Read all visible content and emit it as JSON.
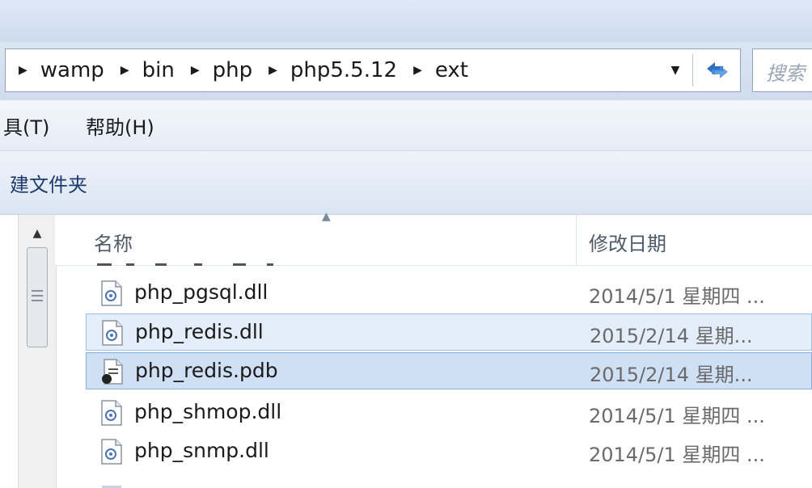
{
  "address": {
    "crumbs": [
      "wamp",
      "bin",
      "php",
      "php5.5.12",
      "ext"
    ],
    "search_placeholder": "搜索"
  },
  "menu": {
    "tools": "具(T)",
    "help": "帮助(H)"
  },
  "toolbar": {
    "new_folder": "建文件夹"
  },
  "columns": {
    "name": "名称",
    "date": "修改日期"
  },
  "files": [
    {
      "name": "php_pgsql.dll",
      "date": "2014/5/1 星期四 ...",
      "icon": "dll-file-icon",
      "state": "normal"
    },
    {
      "name": "php_redis.dll",
      "date": "2015/2/14 星期...",
      "icon": "dll-file-icon",
      "state": "selected"
    },
    {
      "name": "php_redis.pdb",
      "date": "2015/2/14 星期...",
      "icon": "pdb-file-icon",
      "state": "selected-focus"
    },
    {
      "name": "php_shmop.dll",
      "date": "2014/5/1 星期四 ...",
      "icon": "dll-file-icon",
      "state": "normal"
    },
    {
      "name": "php_snmp.dll",
      "date": "2014/5/1 星期四 ...",
      "icon": "dll-file-icon",
      "state": "normal"
    }
  ],
  "colors": {
    "selection": "#e4eefb",
    "selection_border": "#9fc0e8",
    "selection_focus": "#cfe0f5",
    "toolbar_text": "#1e3a6e"
  }
}
